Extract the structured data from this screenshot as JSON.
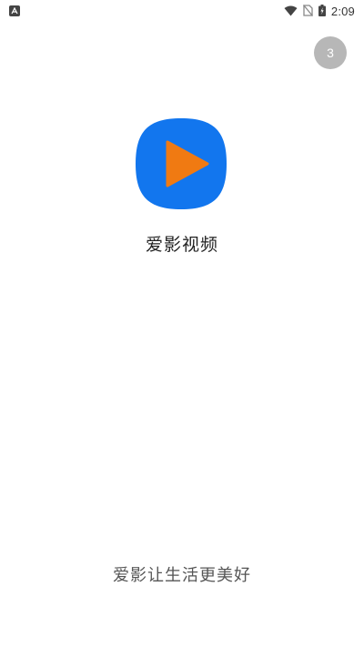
{
  "status_bar": {
    "time": "2:09",
    "notification_icon": "a-notification-icon",
    "icons": [
      "wifi-icon",
      "no-sim-icon",
      "battery-charging-icon"
    ]
  },
  "splash": {
    "skip_countdown": "3",
    "app_name": "爱影视频",
    "slogan": "爱影让生活更美好",
    "logo_icon": "play-logo-icon"
  },
  "colors": {
    "logo_bg": "#1276ee",
    "play_triangle": "#f07a12",
    "skip_bg": "#b7b7b7"
  }
}
